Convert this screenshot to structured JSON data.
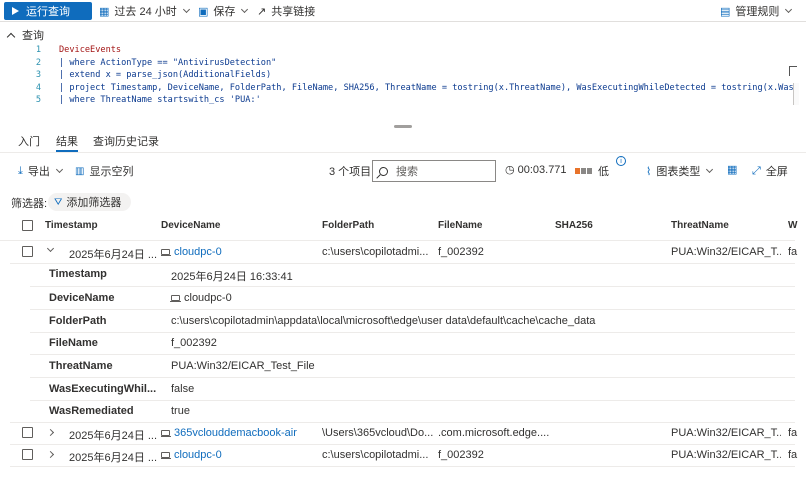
{
  "toolbar": {
    "run_label": "运行查询",
    "time_label": "过去 24 小时",
    "save_label": "保存",
    "share_label": "共享链接",
    "manage_label": "管理规则"
  },
  "query": {
    "header": "查询",
    "lines": [
      {
        "n": "1",
        "text": "DeviceEvents"
      },
      {
        "n": "2",
        "text": "| where ActionType == \"AntivirusDetection\""
      },
      {
        "n": "3",
        "text": "| extend x = parse_json(AdditionalFields)"
      },
      {
        "n": "4",
        "text": "| project Timestamp, DeviceName, FolderPath, FileName, SHA256, ThreatName = tostring(x.ThreatName), WasExecutingWhileDetected = tostring(x.WasExecuti"
      },
      {
        "n": "5",
        "text": "| where ThreatName startswith_cs 'PUA:'"
      }
    ]
  },
  "tabs": [
    "入门",
    "结果",
    "查询历史记录"
  ],
  "results_toolbar": {
    "export_label": "导出",
    "show_empty_label": "显示空列",
    "count_label": "3 个项目",
    "search_placeholder": "搜索",
    "duration": "00:03.771",
    "perf_label": "低",
    "chart_type_label": "图表类型",
    "fullscreen_label": "全屏"
  },
  "filters": {
    "label": "筛选器:",
    "add_label": "添加筛选器"
  },
  "table": {
    "columns": [
      "Timestamp",
      "DeviceName",
      "FolderPath",
      "FileName",
      "SHA256",
      "ThreatName",
      "W"
    ],
    "rows": [
      {
        "timestamp": "2025年6月24日 ...",
        "device": "cloudpc-0",
        "folder": "c:\\users\\copilotadmi...",
        "file": "f_002392",
        "sha": "",
        "threat": "PUA:Win32/EICAR_T...",
        "w": "fa"
      },
      {
        "timestamp": "2025年6月24日 ...",
        "device": "365vclouddemacbook-air",
        "folder": "\\Users\\365vcloud\\Do...",
        "file": ".com.microsoft.edge....",
        "sha": "",
        "threat": "PUA:Win32/EICAR_T...",
        "w": "fa"
      },
      {
        "timestamp": "2025年6月24日 ...",
        "device": "cloudpc-0",
        "folder": "c:\\users\\copilotadmi...",
        "file": "f_002392",
        "sha": "",
        "threat": "PUA:Win32/EICAR_T...",
        "w": "fa"
      }
    ],
    "detail": [
      {
        "k": "Timestamp",
        "v": "2025年6月24日 16:33:41"
      },
      {
        "k": "DeviceName",
        "v": "cloudpc-0"
      },
      {
        "k": "FolderPath",
        "v": "c:\\users\\copilotadmin\\appdata\\local\\microsoft\\edge\\user data\\default\\cache\\cache_data"
      },
      {
        "k": "FileName",
        "v": "f_002392"
      },
      {
        "k": "ThreatName",
        "v": "PUA:Win32/EICAR_Test_File"
      },
      {
        "k": "WasExecutingWhil...",
        "v": "false"
      },
      {
        "k": "WasRemediated",
        "v": "true"
      }
    ]
  },
  "colors": {
    "accent": "#0f6cbd",
    "perf_bar": "#e8732a",
    "perf_bar_dim": "#8a8886"
  }
}
